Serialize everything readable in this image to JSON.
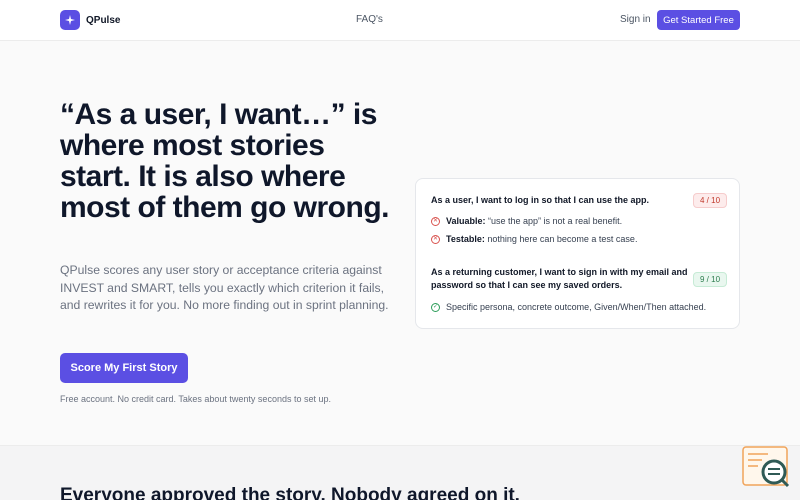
{
  "brand": {
    "name": "QPulse"
  },
  "nav": {
    "faq": "FAQ's",
    "sign_in": "Sign in",
    "cta": "Get Started Free"
  },
  "hero": {
    "headline": "“As a user, I want…” is where most stories start. It is also where most of them go wrong.",
    "subtext": "QPulse scores any user story or acceptance criteria against INVEST and SMART, tells you exactly which criterion it fails, and rewrites it for you. No more finding out in sprint planning.",
    "cta": "Score My First Story",
    "note": "Free account. No credit card. Takes about twenty seconds to set up."
  },
  "card": {
    "stories": [
      {
        "title": "As a user, I want to log in so that I can use the app.",
        "score": "4 / 10",
        "checks": [
          {
            "status": "fail",
            "label": "Valuable:",
            "text": " “use the app” is not a real benefit."
          },
          {
            "status": "fail",
            "label": "Testable:",
            "text": " nothing here can become a test case."
          }
        ]
      },
      {
        "title": "As a returning customer, I want to sign in with my email and password so that I can see my saved orders.",
        "score": "9 / 10",
        "checks": [
          {
            "status": "pass",
            "label": "",
            "text": "Specific persona, concrete outcome, Given/When/Then attached."
          }
        ]
      }
    ]
  },
  "lower": {
    "heading": "Everyone approved the story. Nobody agreed on it."
  },
  "colors": {
    "accent": "#5b4fe3",
    "fail": "#d9534f",
    "pass": "#2e9e5b"
  },
  "icons": {
    "logo": "sparkle-icon",
    "fail": "x-circle-icon",
    "pass": "check-circle-icon",
    "widget": "chat-search-icon"
  }
}
